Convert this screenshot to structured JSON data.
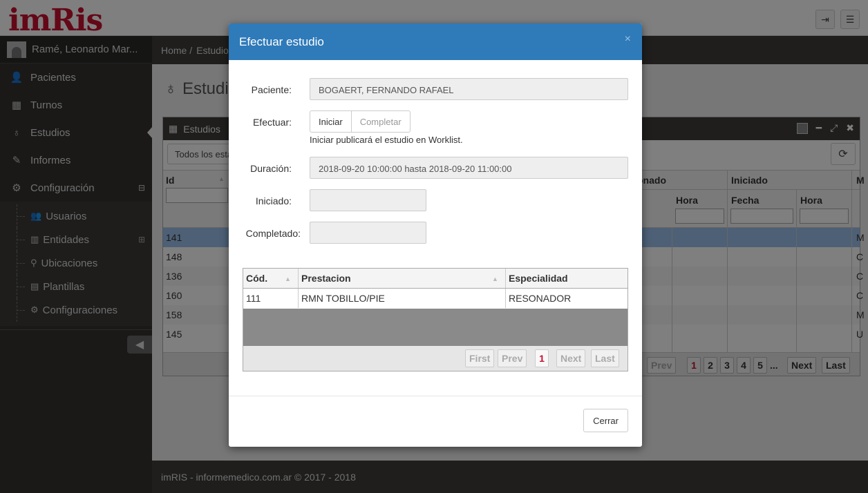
{
  "app": {
    "logo": "imRis"
  },
  "sidebar": {
    "user": "Ramé, Leonardo Mar...",
    "items": [
      {
        "label": "Pacientes",
        "icon": "user-icon"
      },
      {
        "label": "Turnos",
        "icon": "calendar-icon"
      },
      {
        "label": "Estudios",
        "icon": "stethoscope-icon"
      },
      {
        "label": "Informes",
        "icon": "edit-icon"
      },
      {
        "label": "Configuración",
        "icon": "gear-icon"
      }
    ],
    "subitems": [
      {
        "label": "Usuarios",
        "icon": "users-icon"
      },
      {
        "label": "Entidades",
        "icon": "building-icon"
      },
      {
        "label": "Ubicaciones",
        "icon": "map-pin-icon"
      },
      {
        "label": "Plantillas",
        "icon": "file-icon"
      },
      {
        "label": "Configuraciones",
        "icon": "gears-icon"
      }
    ]
  },
  "breadcrumb": {
    "home": "Home /",
    "current": "Estudio"
  },
  "page": {
    "title": "Estudi"
  },
  "panel": {
    "title": "Estudios",
    "filter": "Todos los esta",
    "headers": {
      "id": "Id",
      "group1": "onado",
      "hora1": "Hora",
      "group2": "Iniciado",
      "fecha": "Fecha",
      "hora2": "Hora",
      "last": "M"
    },
    "rows": [
      {
        "id": "141",
        "m": "M"
      },
      {
        "id": "148",
        "m": "C"
      },
      {
        "id": "136",
        "m": "C"
      },
      {
        "id": "160",
        "m": "C"
      },
      {
        "id": "158",
        "m": "M"
      },
      {
        "id": "145",
        "m": "U"
      }
    ],
    "pager": {
      "prev": "Prev",
      "pages": [
        "1",
        "2",
        "3",
        "4",
        "5"
      ],
      "ellipsis": "...",
      "next": "Next",
      "last": "Last"
    }
  },
  "footer": "imRIS - informemedico.com.ar © 2017 - 2018",
  "modal": {
    "title": "Efectuar estudio",
    "paciente_label": "Paciente:",
    "paciente_value": "BOGAERT, FERNANDO RAFAEL",
    "efectuar_label": "Efectuar:",
    "iniciar": "Iniciar",
    "completar": "Completar",
    "hint": "Iniciar publicará el estudio en Worklist.",
    "duracion_label": "Duración:",
    "duracion_value": "2018-09-20 10:00:00 hasta 2018-09-20 11:00:00",
    "iniciado_label": "Iniciado:",
    "completado_label": "Completado:",
    "table": {
      "headers": {
        "cod": "Cód.",
        "prestacion": "Prestacion",
        "especialidad": "Especialidad"
      },
      "rows": [
        {
          "cod": "111",
          "prestacion": "RMN TOBILLO/PIE",
          "especialidad": "RESONADOR"
        }
      ],
      "pager": {
        "first": "First",
        "prev": "Prev",
        "page": "1",
        "next": "Next",
        "last": "Last"
      }
    },
    "close_button": "Cerrar"
  },
  "colors": {
    "brand": "#c8102e",
    "modal_header": "#2f7ab9",
    "selected_row": "#9dc0ec"
  }
}
